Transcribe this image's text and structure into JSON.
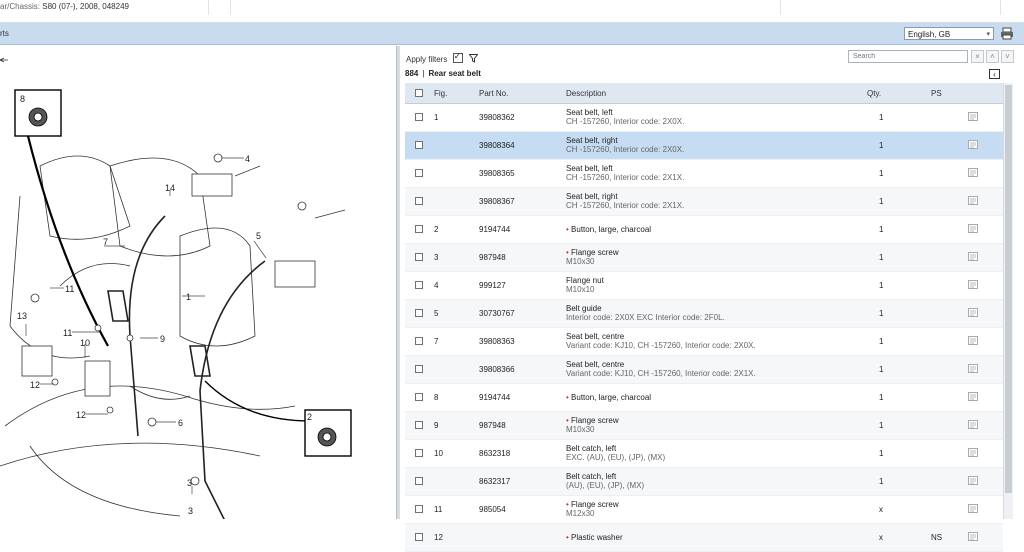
{
  "header": {
    "model_label": "ar/Chassis:",
    "model_value": "S80 (07-), 2008, 048249",
    "panel_title": "rts",
    "language": "English, GB"
  },
  "filters": {
    "apply_label": "Apply filters",
    "checked": true
  },
  "search": {
    "placeholder": "Search"
  },
  "group": {
    "code": "884",
    "name": "Rear seat belt"
  },
  "table": {
    "headers": {
      "fig": "Fig.",
      "part": "Part No.",
      "desc": "Description",
      "qty": "Qty.",
      "ps": "PS"
    },
    "rows": [
      {
        "fig": "1",
        "part": "39808362",
        "d1": "Seat belt, left",
        "d2": "CH -157260, Interior code: 2X0X.",
        "qty": "1",
        "ps": "",
        "bullet": false
      },
      {
        "fig": "",
        "part": "39808364",
        "d1": "Seat belt, right",
        "d2": "CH -157260, Interior code: 2X0X.",
        "qty": "1",
        "ps": "",
        "bullet": false
      },
      {
        "fig": "",
        "part": "39808365",
        "d1": "Seat belt, left",
        "d2": "CH -157260, Interior code: 2X1X.",
        "qty": "1",
        "ps": "",
        "bullet": false
      },
      {
        "fig": "",
        "part": "39808367",
        "d1": "Seat belt, right",
        "d2": "CH -157260, Interior code: 2X1X.",
        "qty": "1",
        "ps": "",
        "bullet": false
      },
      {
        "fig": "2",
        "part": "9194744",
        "d1": "Button, large, charcoal",
        "d2": "",
        "qty": "1",
        "ps": "",
        "bullet": true
      },
      {
        "fig": "3",
        "part": "987948",
        "d1": "Flange screw",
        "d2": "M10x30",
        "qty": "1",
        "ps": "",
        "bullet": true
      },
      {
        "fig": "4",
        "part": "999127",
        "d1": "Flange nut",
        "d2": "M10x10",
        "qty": "1",
        "ps": "",
        "bullet": false
      },
      {
        "fig": "5",
        "part": "30730767",
        "d1": "Belt guide",
        "d2": "Interior code: 2X0X EXC Interior code: 2F0L.",
        "qty": "1",
        "ps": "",
        "bullet": false
      },
      {
        "fig": "7",
        "part": "39808363",
        "d1": "Seat belt, centre",
        "d2": "Variant code: KJ10, CH -157260, Interior code: 2X0X.",
        "qty": "1",
        "ps": "",
        "bullet": false
      },
      {
        "fig": "",
        "part": "39808366",
        "d1": "Seat belt, centre",
        "d2": "Variant code: KJ10, CH -157260, Interior code: 2X1X.",
        "qty": "1",
        "ps": "",
        "bullet": false
      },
      {
        "fig": "8",
        "part": "9194744",
        "d1": "Button, large, charcoal",
        "d2": "",
        "qty": "1",
        "ps": "",
        "bullet": true
      },
      {
        "fig": "9",
        "part": "987948",
        "d1": "Flange screw",
        "d2": "M10x30",
        "qty": "1",
        "ps": "",
        "bullet": true
      },
      {
        "fig": "10",
        "part": "8632318",
        "d1": "Belt catch, left",
        "d2": "EXC. (AU), (EU), (JP), (MX)",
        "qty": "1",
        "ps": "",
        "bullet": false
      },
      {
        "fig": "",
        "part": "8632317",
        "d1": "Belt catch, left",
        "d2": "(AU), (EU), (JP), (MX)",
        "qty": "1",
        "ps": "",
        "bullet": false
      },
      {
        "fig": "11",
        "part": "985054",
        "d1": "Flange screw",
        "d2": "M12x30",
        "qty": "x",
        "ps": "",
        "bullet": true
      },
      {
        "fig": "12",
        "part": "",
        "d1": "Plastic washer",
        "d2": "",
        "qty": "x",
        "ps": "NS",
        "bullet": true
      }
    ]
  },
  "diagram": {
    "callouts": [
      "8",
      "4",
      "14",
      "7",
      "5",
      "1",
      "11",
      "13",
      "11",
      "10",
      "9",
      "12",
      "12",
      "6",
      "2",
      "3",
      "3"
    ]
  },
  "colors": {
    "accent_bar": "#c9dbef",
    "selected_row": "#c6dcf3",
    "header_row": "#dfe7f1",
    "bullet": "#c0392b"
  }
}
